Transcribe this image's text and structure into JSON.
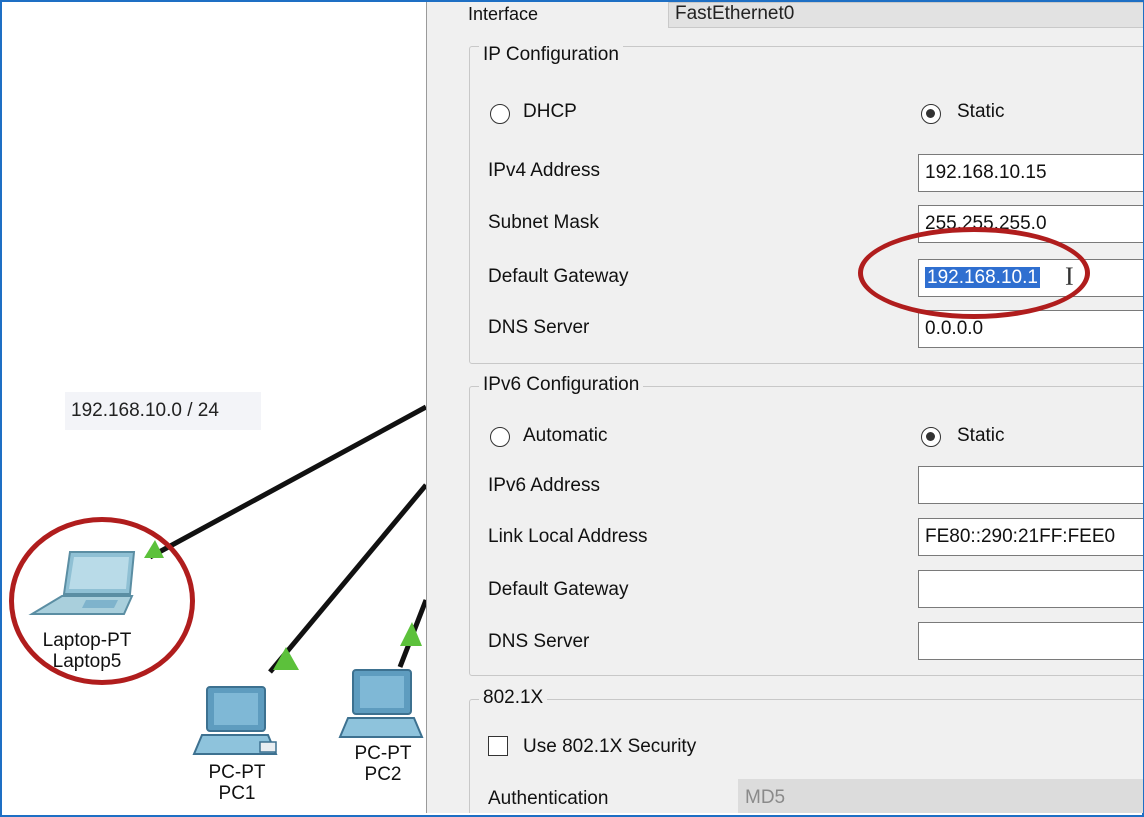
{
  "canvas": {
    "network_label": "192.168.10.0 / 24",
    "devices": [
      {
        "model": "Laptop-PT",
        "name": "Laptop5"
      },
      {
        "model": "PC-PT",
        "name": "PC1"
      },
      {
        "model": "PC-PT",
        "name": "PC2"
      }
    ],
    "link_color": "#111111",
    "link_light_color": "#5cc13b",
    "device_color": "#7fb3cc"
  },
  "dialog": {
    "interface_label": "Interface",
    "interface_value": "FastEthernet0",
    "ipv4": {
      "title": "IP Configuration",
      "dhcp_label": "DHCP",
      "static_label": "Static",
      "mode_selected": "Static",
      "ipv4_address_label": "IPv4 Address",
      "ipv4_address_value": "192.168.10.15",
      "subnet_mask_label": "Subnet Mask",
      "subnet_mask_value": "255.255.255.0",
      "default_gateway_label": "Default Gateway",
      "default_gateway_value": "192.168.10.1",
      "dns_server_label": "DNS Server",
      "dns_server_value": "0.0.0.0"
    },
    "ipv6": {
      "title": "IPv6 Configuration",
      "automatic_label": "Automatic",
      "static_label": "Static",
      "mode_selected": "Static",
      "ipv6_address_label": "IPv6 Address",
      "ipv6_address_value": "",
      "link_local_label": "Link Local Address",
      "link_local_value": "FE80::290:21FF:FEE0",
      "default_gateway_label": "Default Gateway",
      "default_gateway_value": "",
      "dns_server_label": "DNS Server",
      "dns_server_value": ""
    },
    "dot1x": {
      "title": "802.1X",
      "use_security_label": "Use 802.1X Security",
      "use_security_checked": false,
      "authentication_label": "Authentication",
      "authentication_value": "MD5"
    }
  },
  "annotation_color": "#b01d1d",
  "selection_color": "#2f6fd0"
}
